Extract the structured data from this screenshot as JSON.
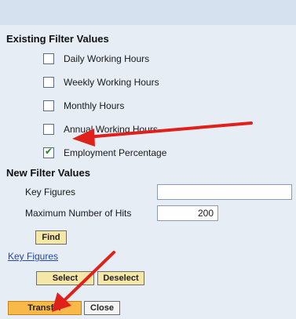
{
  "existing_filters": {
    "title": "Existing Filter Values",
    "items": [
      {
        "label": "Daily Working Hours",
        "checked": false
      },
      {
        "label": "Weekly Working Hours",
        "checked": false
      },
      {
        "label": "Monthly Hours",
        "checked": false
      },
      {
        "label": "Annual Working Hours",
        "checked": false
      },
      {
        "label": "Employment Percentage",
        "checked": true
      }
    ]
  },
  "new_filters": {
    "title": "New Filter Values",
    "key_figures_label": "Key Figures",
    "key_figures_value": "",
    "max_hits_label": "Maximum Number of Hits",
    "max_hits_value": "200"
  },
  "buttons": {
    "find": "Find",
    "select": "Select",
    "deselect": "Deselect",
    "transfer": "Transfer",
    "close": "Close"
  },
  "links": {
    "key_figures": "Key Figures"
  },
  "colors": {
    "panel_bg": "#e6edf5",
    "arrow": "#e0201b",
    "primary_button": "#f8b94a"
  }
}
